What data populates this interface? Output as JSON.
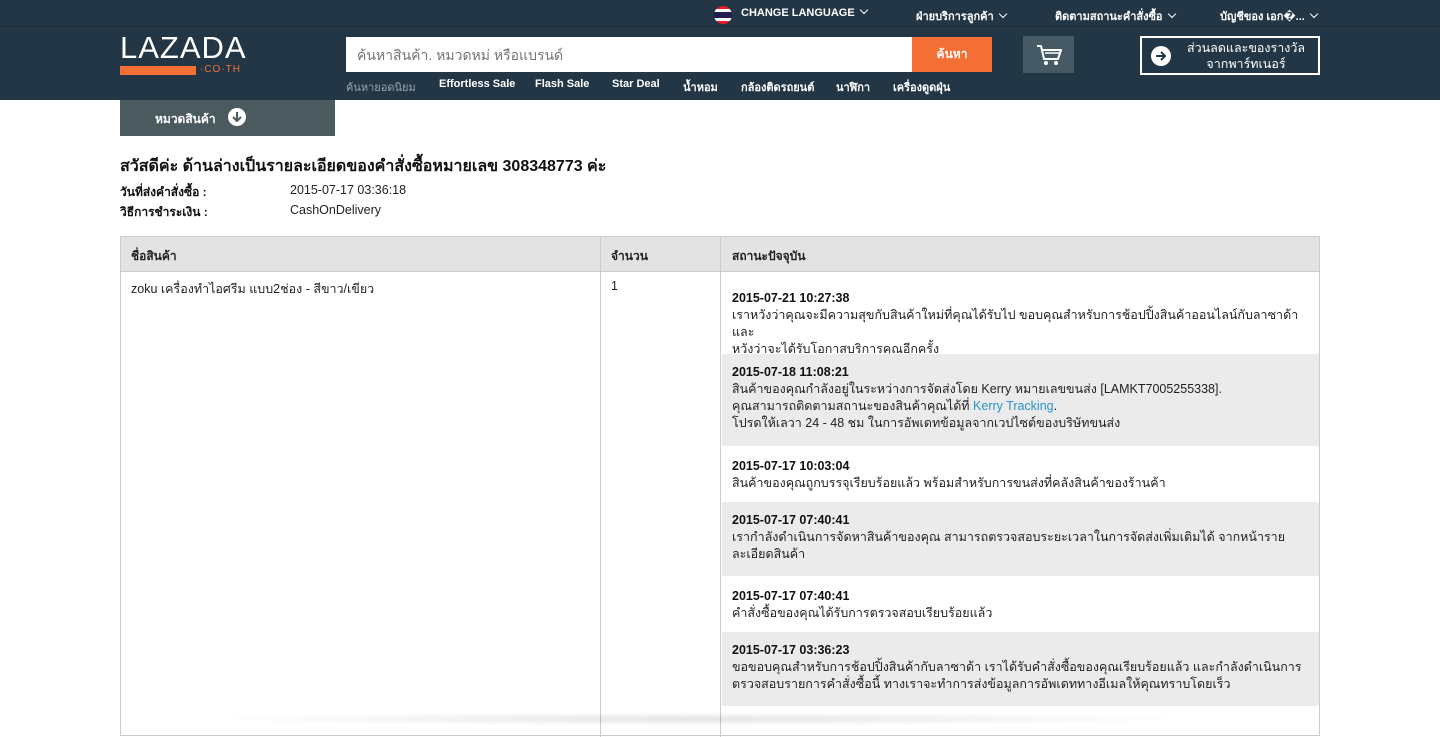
{
  "topbar": {
    "change_language": "CHANGE LANGUAGE",
    "customer_service": "ฝ่ายบริการลูกค้า",
    "track_order": "ติดตามสถานะคำสั่งซื้อ",
    "account": "บัญชีของ เอก�..."
  },
  "header": {
    "logo": "LAZADA",
    "logo_sub": "·CO·TH",
    "search_placeholder": "ค้นหาสินค้า. หมวดหม่ หรือแบรนด์",
    "search_button": "ค้นหา",
    "promo_line1": "ส่วนลดและของรางวัล",
    "promo_line2": "จากพาร์ทเนอร์",
    "quicklinks": [
      "ค้นหายอดนิยม",
      "Effortless Sale",
      "Flash Sale",
      "Star Deal",
      "น้ำหอม",
      "กล้องติดรถยนต์",
      "นาฬิกา",
      "เครื่องดูดฝุ่น"
    ]
  },
  "category_button": "หมวดสินค้า",
  "order": {
    "greeting": "สวัสดีค่ะ ด้านล่างเป็นรายละเอียดของคำสั่งซื้อหมายเลข 308348773 ค่ะ",
    "date_label": "วันที่ส่งคำสั่งซื้อ :",
    "date_value": "2015-07-17 03:36:18",
    "payment_label": "วิธีการชำระเงิน :",
    "payment_value": "CashOnDelivery"
  },
  "table": {
    "headers": [
      "ชื่อสินค้า",
      "จำนวน",
      "สถานะปัจจุบัน"
    ],
    "product": "zoku เครื่องทำไอศรีม แบบ2ช่อง - สีขาว/เขียว",
    "quantity": "1",
    "statuses": [
      {
        "time": "2015-07-21 10:27:38",
        "lines": [
          "เราหวังว่าคุณจะมีความสุขกับสินค้าใหม่ที่คุณได้รับไป ขอบคุณสำหรับการช้อปปิ้งสินค้าออนไลน์กับลาซาด้า และ",
          "หวังว่าจะได้รับโอกาสบริการคุณอีกครั้ง"
        ]
      },
      {
        "time": "2015-07-18 11:08:21",
        "line1": "สินค้าของคุณกำลังอยู่ในระหว่างการจัดส่งโดย Kerry หมายเลขขนส่ง [LAMKT7005255338].",
        "line2_pre": "คุณสามารถติดตามสถานะของสินค้าคุณได้ที่ ",
        "link": "Kerry Tracking",
        "line2_post": ".",
        "line3": "โปรดให้เลวา 24 - 48 ชม ในการอัพเดทข้อมูลจากเวปไซต์ของบริษัทขนส่ง"
      },
      {
        "time": "2015-07-17 10:03:04",
        "lines": [
          "สินค้าของคุณถูกบรรจุเรียบร้อยแล้ว พร้อมสำหรับการขนส่งที่คลังสินค้าของร้านค้า"
        ]
      },
      {
        "time": "2015-07-17 07:40:41",
        "lines": [
          "เรากำลังดำเนินการจัดหาสินค้าของคุณ สามารถตรวจสอบระยะเวลาในการจัดส่งเพิ่มเติมได้ จากหน้าราย",
          "ละเอียดสินค้า"
        ]
      },
      {
        "time": "2015-07-17 07:40:41",
        "lines": [
          "คำสั่งซื้อของคุณได้รับการตรวจสอบเรียบร้อยแล้ว"
        ]
      },
      {
        "time": "2015-07-17 03:36:23",
        "lines": [
          "ขอขอบคุณสำหรับการช้อปปิ้งสินค้ากับลาซาด้า เราได้รับคำสั่งซื้อของคุณเรียบร้อยแล้ว และกำลังดำเนินการ",
          "ตรวจสอบรายการคำสั่งซื้อนี้ ทางเราจะทำการส่งข้อมูลการอัพเดททางอีเมลให้คุณทราบโดยเร็ว"
        ]
      }
    ]
  },
  "colors": {
    "header_bg": "#233645",
    "accent": "#f36f36",
    "link": "#2c93c8"
  }
}
